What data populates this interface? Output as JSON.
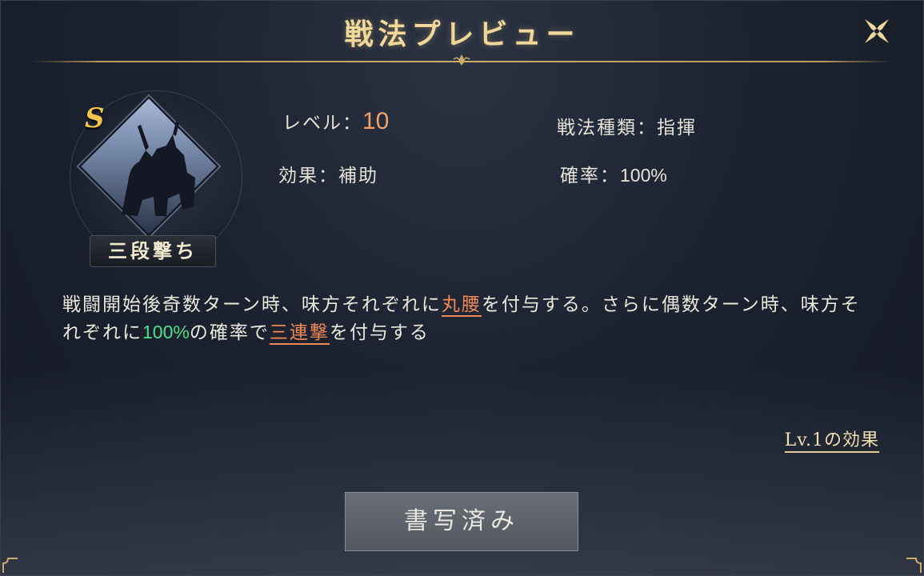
{
  "dialog": {
    "title": "戦法プレビュー"
  },
  "skill": {
    "grade": "S",
    "name": "三段撃ち",
    "level_label": "レベル：",
    "level_value": "10",
    "type_label": "戦法種類：",
    "type_value": "指揮",
    "effect_label": "効果：",
    "effect_value": "補助",
    "rate_label": "確率：",
    "rate_value": "100%"
  },
  "description": {
    "part1": "戦闘開始後奇数ターン時、味方それぞれに",
    "keyword1": "丸腰",
    "part2": "を付与する。さらに偶数ターン時、味方それぞれに",
    "percent": "100%",
    "part3": "の確率で",
    "keyword2": "三連撃",
    "part4": "を付与する"
  },
  "links": {
    "lv1_effect": "Lv.1の効果"
  },
  "buttons": {
    "copied": "書写済み"
  },
  "colors": {
    "title_gold": "#f0d89a",
    "level_orange": "#f3a26a",
    "keyword_orange": "#f08856",
    "percent_green": "#4fe08a"
  },
  "icons": [
    "close-icon",
    "title-ornament-icon",
    "skill-silhouette-icon"
  ]
}
